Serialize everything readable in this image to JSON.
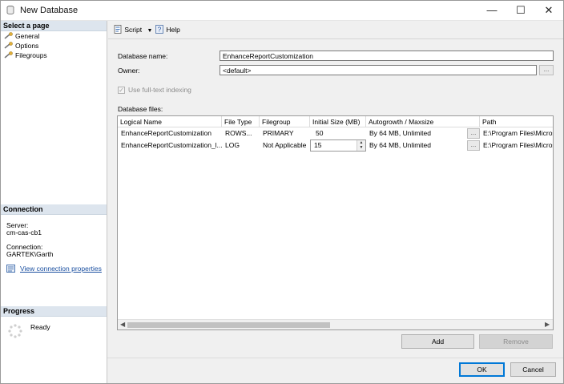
{
  "window": {
    "title": "New Database",
    "minimize": "—",
    "maximize": "☐",
    "close": "✕"
  },
  "sidebar": {
    "select_page_header": "Select a page",
    "pages": [
      {
        "label": "General"
      },
      {
        "label": "Options"
      },
      {
        "label": "Filegroups"
      }
    ],
    "connection_header": "Connection",
    "server_label": "Server:",
    "server_value": "cm-cas-cb1",
    "connection_label": "Connection:",
    "connection_value": "GARTEK\\Garth",
    "view_connection_link": "View connection properties",
    "progress_header": "Progress",
    "progress_status": "Ready"
  },
  "toolbar": {
    "script_label": "Script",
    "help_label": "Help"
  },
  "form": {
    "db_name_label": "Database name:",
    "db_name_value": "EnhanceReportCustomization",
    "owner_label": "Owner:",
    "owner_value": "<default>",
    "owner_browse": "...",
    "fulltext_label": "Use full-text indexing",
    "fulltext_checked": true,
    "files_label": "Database files:"
  },
  "files_table": {
    "columns": [
      "Logical Name",
      "File Type",
      "Filegroup",
      "Initial Size (MB)",
      "Autogrowth / Maxsize",
      "Path"
    ],
    "rows": [
      {
        "logical_name": "EnhanceReportCustomization",
        "file_type": "ROWS...",
        "filegroup": "PRIMARY",
        "initial_size": "50",
        "autogrowth": "By 64 MB, Unlimited",
        "browse": "...",
        "path": "E:\\Program Files\\Micros"
      },
      {
        "logical_name": "EnhanceReportCustomization_l...",
        "file_type": "LOG",
        "filegroup": "Not Applicable",
        "initial_size": "15",
        "autogrowth": "By 64 MB, Unlimited",
        "browse": "...",
        "path": "E:\\Program Files\\Micros"
      }
    ]
  },
  "buttons": {
    "add": "Add",
    "remove": "Remove",
    "ok": "OK",
    "cancel": "Cancel"
  },
  "colors": {
    "section_header_bg": "#dde5ee",
    "link": "#1a4fa0",
    "default_button_border": "#0078d7"
  }
}
